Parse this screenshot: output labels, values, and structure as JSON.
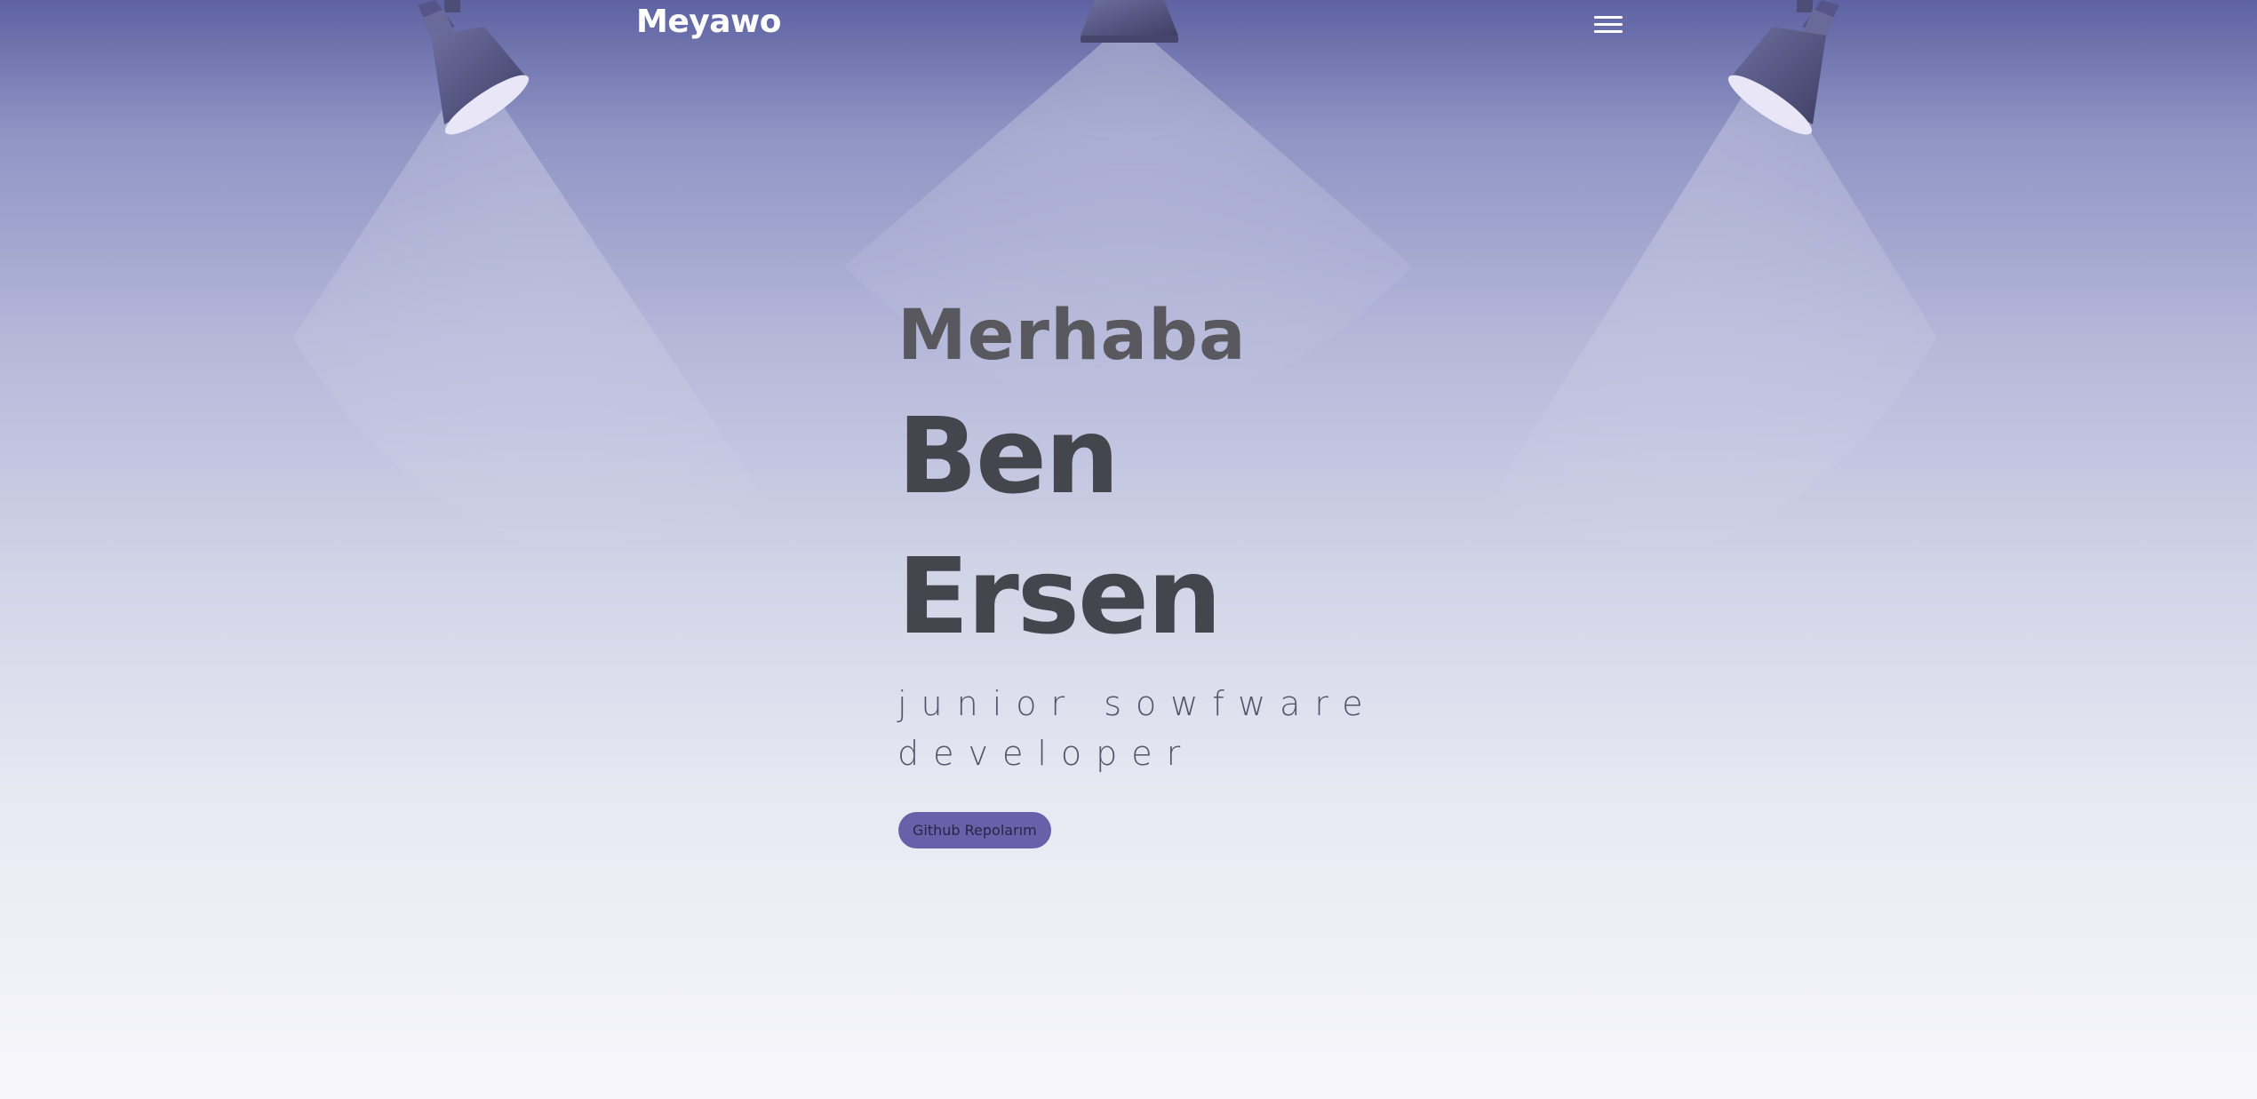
{
  "header": {
    "logo": "Meyawo",
    "menu_icon": "hamburger-menu-icon"
  },
  "hero": {
    "greeting": "Merhaba",
    "name_first": "Ben",
    "name_last": "Ersen",
    "subtitle": "junior sowfware developer",
    "cta_label": "Github Repolarım"
  },
  "decor": {
    "left_spotlight_icon": "spotlight-icon",
    "center_spotlight_icon": "spotlight-icon",
    "right_spotlight_icon": "spotlight-icon"
  },
  "colors": {
    "background_top": "#5d62a2",
    "background_bottom": "#f7f7fb",
    "accent": "#6a60a9",
    "heading": "#45464d",
    "greeting": "#58585e"
  }
}
